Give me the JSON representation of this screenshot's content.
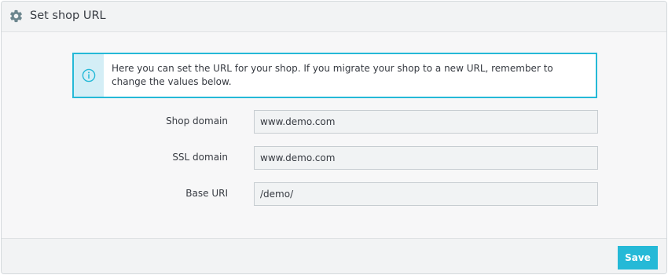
{
  "panel": {
    "title": "Set shop URL",
    "icon": "gear-icon"
  },
  "alert": {
    "icon": "info-icon",
    "text": "Here you can set the URL for your shop. If you migrate your shop to a new URL, remember to change the values below.",
    "border_color": "#25b9d7"
  },
  "form": {
    "shop_domain": {
      "label": "Shop domain",
      "value": "www.demo.com"
    },
    "ssl_domain": {
      "label": "SSL domain",
      "value": "www.demo.com"
    },
    "base_uri": {
      "label": "Base URI",
      "value": "/demo/"
    }
  },
  "footer": {
    "save_label": "Save",
    "save_color": "#25b9d7"
  }
}
